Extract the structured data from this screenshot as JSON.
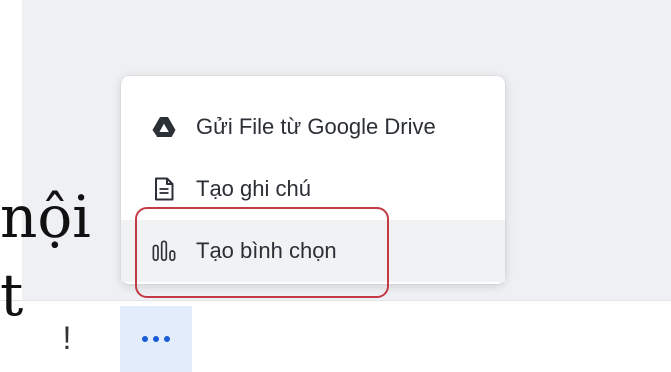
{
  "background_text": {
    "line1": "nội",
    "line2": "t"
  },
  "menu": {
    "items": [
      {
        "label": "Gửi File từ Google Drive",
        "icon": "google-drive-icon"
      },
      {
        "label": "Tạo ghi chú",
        "icon": "note-document-icon"
      },
      {
        "label": "Tạo bình chọn",
        "icon": "poll-bars-icon",
        "state": "hovered"
      }
    ]
  },
  "toolbar": {
    "exclamation_label": "!",
    "more_icon": "more-horizontal-icon"
  },
  "colors": {
    "highlight_border": "#c33a45",
    "more_button_bg": "#e3ecfb",
    "more_dots": "#1a5bd6",
    "menu_text": "#2b2f36"
  }
}
